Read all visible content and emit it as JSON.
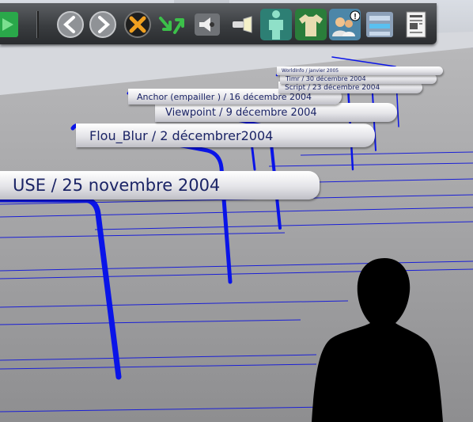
{
  "toolbar": {
    "buttons": [
      {
        "name": "play-button",
        "icon": "play-icon"
      },
      {
        "name": "back-button",
        "icon": "arrow-left-icon"
      },
      {
        "name": "forward-button",
        "icon": "arrow-right-icon"
      },
      {
        "name": "exit-button",
        "icon": "close-icon"
      },
      {
        "name": "jump-button",
        "icon": "jump-arrows-icon"
      },
      {
        "name": "sound-button",
        "icon": "speaker-icon"
      },
      {
        "name": "light-button",
        "icon": "flashlight-icon"
      },
      {
        "name": "avatar-button",
        "icon": "avatar-body-icon"
      },
      {
        "name": "clothing-button",
        "icon": "shirt-icon"
      },
      {
        "name": "users-button",
        "icon": "users-alert-icon"
      },
      {
        "name": "settings-button",
        "icon": "settings-panel-icon"
      },
      {
        "name": "document-button",
        "icon": "document-icon"
      }
    ]
  },
  "timeline_labels": [
    {
      "text": "USE / 25 novembre  2004"
    },
    {
      "text": "Flou_Blur / 2 décembrer2004"
    },
    {
      "text": "Viewpoint / 9 décembre  2004"
    },
    {
      "text": "Anchor (empailler ) / 16 décembre  2004"
    },
    {
      "text": "Script / 23 décembre 2004"
    },
    {
      "text": "Timr / 30 décembre 2004"
    },
    {
      "text": "WorldInfo / janvier 2005"
    }
  ],
  "colors": {
    "ground": "#9a9a9c",
    "grid_lines": "#1a1fd6",
    "label_text": "#1b2466",
    "toolbar": "#3a3d40"
  }
}
